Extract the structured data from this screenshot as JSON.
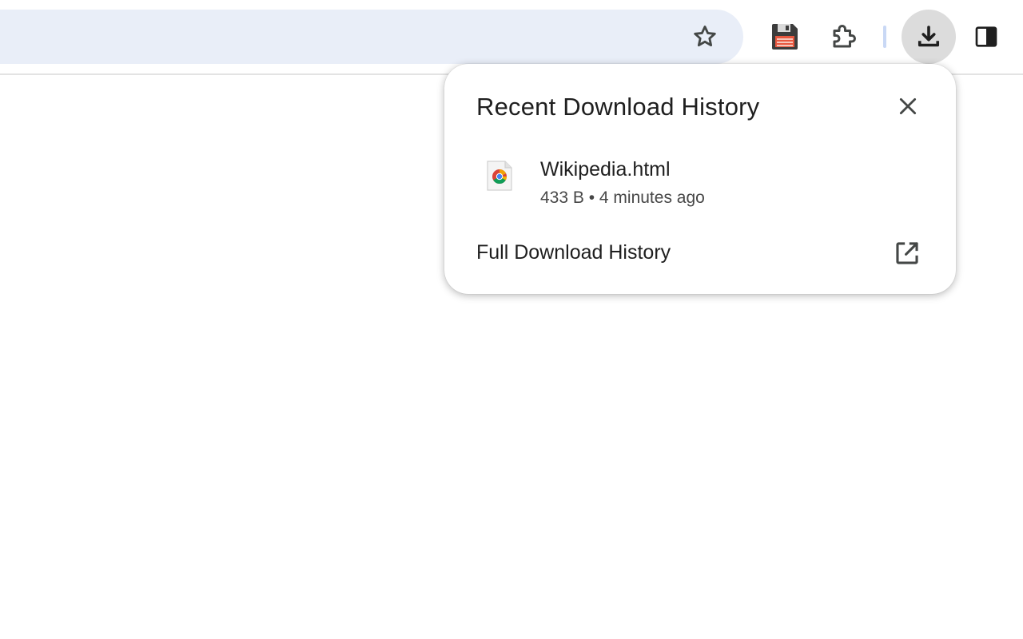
{
  "toolbar": {
    "icons": {
      "bookmark": "star-outline-icon",
      "save_page": "floppy-disk-icon",
      "extensions": "puzzle-piece-icon",
      "downloads": "download-arrow-icon",
      "side_panel": "side-panel-icon"
    }
  },
  "download_bubble": {
    "title": "Recent Download History",
    "items": [
      {
        "filename": "Wikipedia.html",
        "size": "433 B",
        "time": "4 minutes ago",
        "meta": "433 B • 4 minutes ago",
        "icon": "chrome-file-icon"
      }
    ],
    "full_history_label": "Full Download History"
  },
  "colors": {
    "omnibox_bg": "#e9eef8",
    "active_button_bg": "#dcdcdc",
    "text_primary": "#1f1f1f",
    "text_secondary": "#474747"
  }
}
